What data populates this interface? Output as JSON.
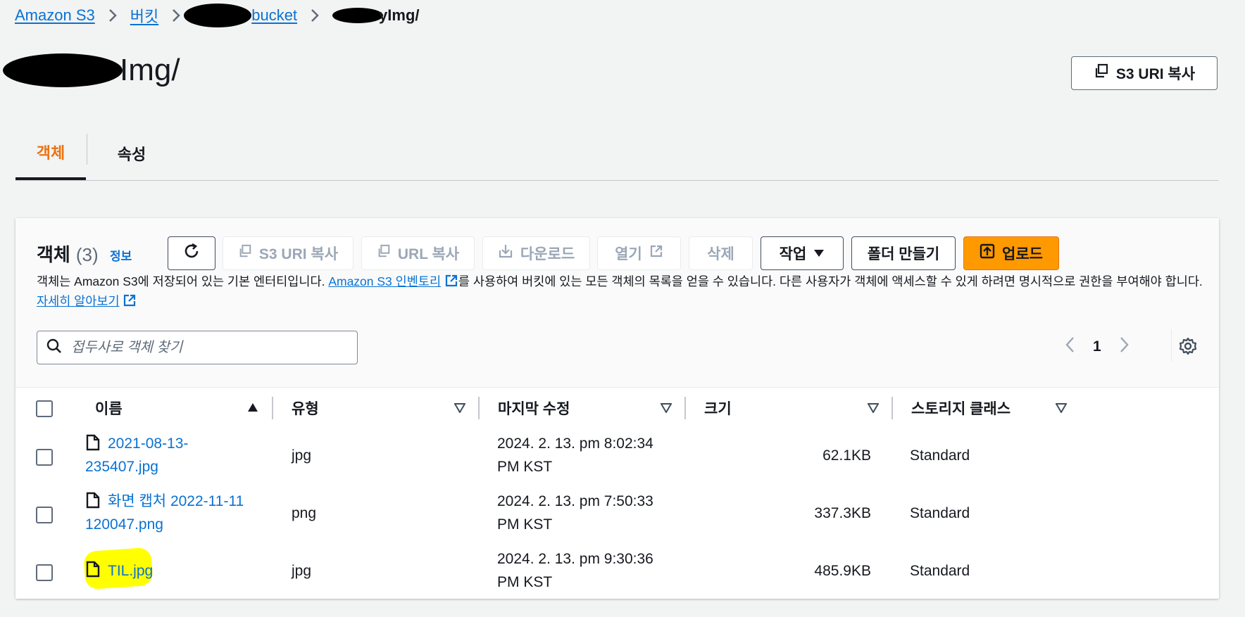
{
  "breadcrumb": {
    "service": "Amazon S3",
    "buckets": "버킷",
    "bucket_suffix": "bucket",
    "folder_suffix": "yImg/"
  },
  "page": {
    "title_suffix": "Img/"
  },
  "header_actions": {
    "copy_s3_uri": "S3 URI 복사"
  },
  "tabs": [
    {
      "label": "객체",
      "selected": true
    },
    {
      "label": "속성",
      "selected": false
    }
  ],
  "objects_panel": {
    "title": "객체",
    "count": "(3)",
    "info_link": "정보",
    "buttons": {
      "copy_s3_uri": "S3 URI 복사",
      "copy_url": "URL 복사",
      "download": "다운로드",
      "open": "열기",
      "delete": "삭제",
      "actions": "작업",
      "create_folder": "폴더 만들기",
      "upload": "업로드"
    },
    "description_1": "객체는 Amazon S3에 저장되어 있는 기본 엔터티입니다. ",
    "inventory_link": "Amazon S3 인벤토리",
    "description_2": "를 사용하여 버킷에 있는 모든 객체의 목록을 얻을 수 있습니다. 다른 사용자가 객체에 액세스할 수 있게 하려면 명시적으로 권한을 부여해야 합니다. ",
    "learn_more": "자세히 알아보기",
    "search_placeholder": "접두사로 객체 찾기",
    "current_page": "1"
  },
  "table": {
    "columns": [
      "이름",
      "유형",
      "마지막 수정",
      "크기",
      "스토리지 클래스"
    ],
    "rows": [
      {
        "name_line1": "2021-08-13-",
        "name_line2": "235407.jpg",
        "type": "jpg",
        "modified_line1": "2024. 2. 13. pm 8:02:34",
        "modified_line2": "PM KST",
        "size": "62.1KB",
        "storage_class": "Standard"
      },
      {
        "name_line1": "화면 캡처 2022-11-11",
        "name_line2": "120047.png",
        "type": "png",
        "modified_line1": "2024. 2. 13. pm 7:50:33",
        "modified_line2": "PM KST",
        "size": "337.3KB",
        "storage_class": "Standard"
      },
      {
        "name_line1": "TIL.jpg",
        "name_line2": "",
        "type": "jpg",
        "modified_line1": "2024. 2. 13. pm 9:30:36",
        "modified_line2": "PM KST",
        "size": "485.9KB",
        "storage_class": "Standard"
      }
    ]
  },
  "colors": {
    "link": "#0972d3",
    "accent_orange": "#ec7211",
    "primary_button": "#ff9900",
    "highlight": "#ffff00"
  }
}
